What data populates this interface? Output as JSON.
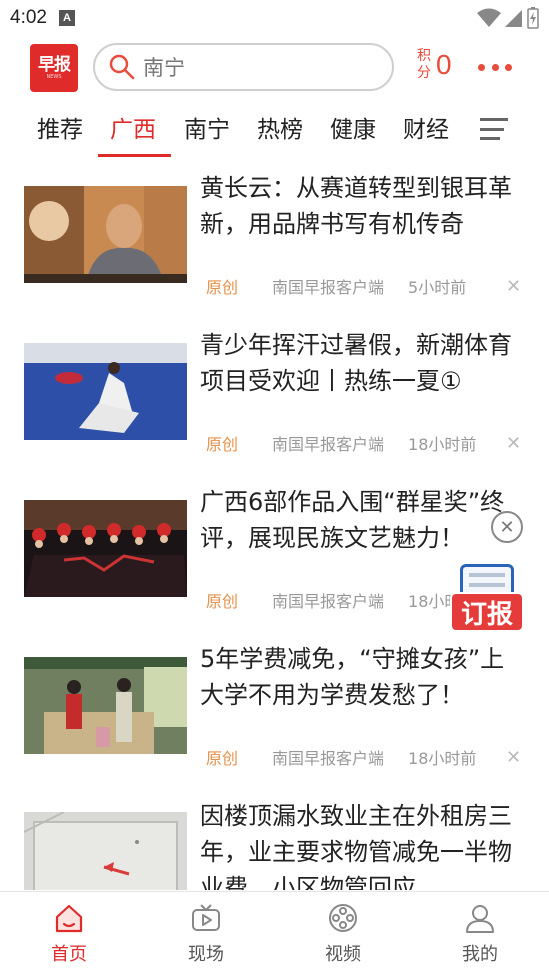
{
  "status_bar": {
    "time": "4:02",
    "notification": "A"
  },
  "header": {
    "logo_text": "早报",
    "logo_sub": "NEWS",
    "search_placeholder": "南宁",
    "points_label": "积分",
    "points_value": "0"
  },
  "tabs": [
    {
      "label": "推荐",
      "active": false
    },
    {
      "label": "广西",
      "active": true
    },
    {
      "label": "南宁",
      "active": false
    },
    {
      "label": "热榜",
      "active": false
    },
    {
      "label": "健康",
      "active": false
    },
    {
      "label": "财经",
      "active": false
    }
  ],
  "articles": [
    {
      "title": "黄长云：从赛道转型到银耳革新，用品牌书写有机传奇",
      "tag": "原创",
      "source": "南国早报客户端",
      "time": "5小时前"
    },
    {
      "title": "青少年挥汗过暑假，新潮体育项目受欢迎丨热练一夏①",
      "tag": "原创",
      "source": "南国早报客户端",
      "time": "18小时前"
    },
    {
      "title": "广西6部作品入围“群星奖”终评，展现民族文艺魅力！",
      "tag": "原创",
      "source": "南国早报客户端",
      "time": "18小时前"
    },
    {
      "title": "5年学费减免，“守摊女孩”上大学不用为学费发愁了！",
      "tag": "原创",
      "source": "南国早报客户端",
      "time": "18小时前"
    },
    {
      "title": "因楼顶漏水致业主在外租房三年，业主要求物管减免一半物业费，小区物管回应……",
      "tag": "",
      "source": "",
      "time": ""
    }
  ],
  "floating_ad": {
    "label": "订报"
  },
  "bottom_nav": [
    {
      "label": "首页",
      "icon": "home-icon",
      "active": true
    },
    {
      "label": "现场",
      "icon": "live-tv-icon",
      "active": false
    },
    {
      "label": "视频",
      "icon": "film-reel-icon",
      "active": false
    },
    {
      "label": "我的",
      "icon": "user-icon",
      "active": false
    }
  ],
  "colors": {
    "brand_red": "#e02b2b",
    "tag_orange": "#e8904a",
    "muted": "#999999"
  }
}
